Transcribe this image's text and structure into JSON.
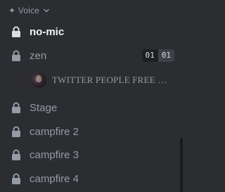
{
  "category": {
    "label": "✦ Voice"
  },
  "channels": [
    {
      "name": "no-mic",
      "active": true
    },
    {
      "name": "zen",
      "active": false,
      "counter": {
        "users": "01",
        "limit": "01"
      }
    },
    {
      "name": "Stage",
      "active": false
    },
    {
      "name": "campfire 2",
      "active": false
    },
    {
      "name": "campfire 3",
      "active": false
    },
    {
      "name": "campfire 4",
      "active": false
    }
  ],
  "voice_member": {
    "name": "TWITTER PEOPLE FREE …",
    "channel": "zen"
  },
  "colors": {
    "background": "#2b2d31",
    "text_muted": "#949ba4",
    "text_active": "#f2f3f5"
  },
  "icons": {
    "channel": "lock-icon",
    "category": "chevron-down-icon"
  }
}
